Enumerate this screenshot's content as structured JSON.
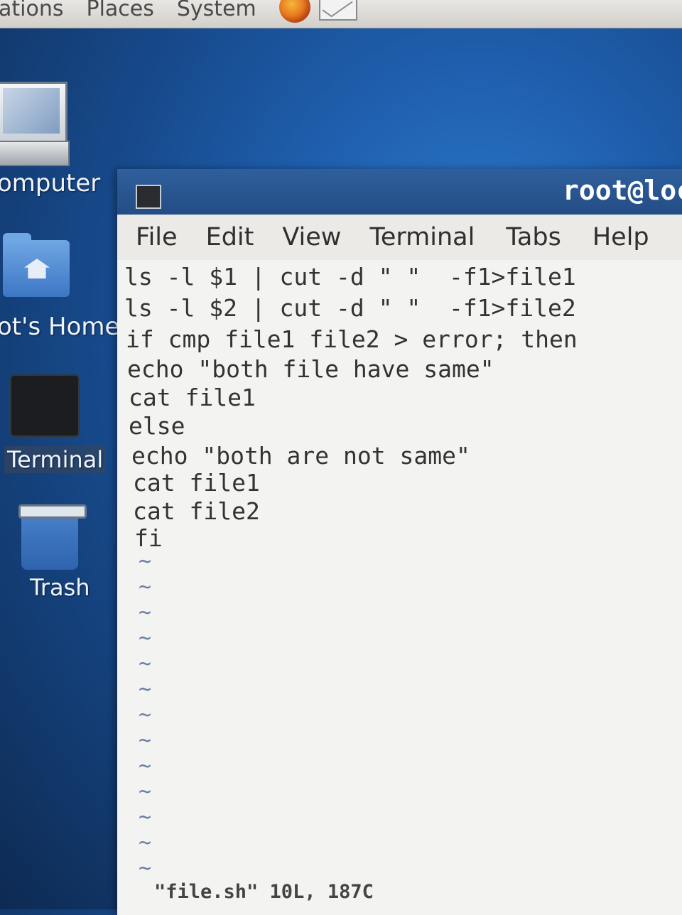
{
  "top_panel": {
    "menus": [
      "ations",
      "Places",
      "System"
    ]
  },
  "desktop": {
    "icons": [
      {
        "label": "omputer",
        "icon": "computer-icon"
      },
      {
        "label": "ot's Home",
        "icon": "home-folder-icon"
      },
      {
        "label": "Terminal",
        "icon": "terminal-icon"
      },
      {
        "label": "Trash",
        "icon": "trash-icon"
      }
    ]
  },
  "window": {
    "title": "root@loc",
    "menus": [
      "File",
      "Edit",
      "View",
      "Terminal",
      "Tabs",
      "Help"
    ]
  },
  "editor": {
    "lines": [
      "ls -l $1 | cut -d \" \"  -f1>file1",
      "ls -l $2 | cut -d \" \"  -f1>file2",
      "if cmp file1 file2 > error; then",
      "echo \"both file have same\"",
      "cat file1",
      "else",
      "echo \"both are not same\"",
      "cat file1",
      "cat file2",
      "fi"
    ],
    "tilde": "~",
    "status": "\"file.sh\" 10L, 187C"
  },
  "colors": {
    "desktop_bg": "#1f5fae",
    "titlebar": "#2f5f9c",
    "editor_bg": "#f3f3f1"
  }
}
